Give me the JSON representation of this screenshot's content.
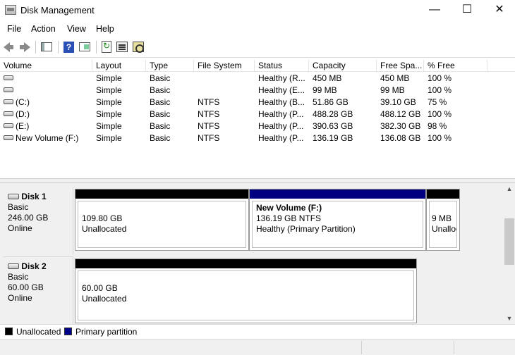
{
  "window": {
    "title": "Disk Management",
    "controls": {
      "minimize": "—",
      "maximize": "☐",
      "close": "✕"
    }
  },
  "menu": [
    "File",
    "Action",
    "View",
    "Help"
  ],
  "toolbar": {
    "icons": [
      "back-arrow-icon",
      "forward-arrow-icon",
      "console-tree-icon",
      "help-icon",
      "action-pane-icon",
      "refresh-icon",
      "properties-icon",
      "rescan-disks-icon"
    ]
  },
  "volume_list": {
    "columns": [
      "Volume",
      "Layout",
      "Type",
      "File System",
      "Status",
      "Capacity",
      "Free Spa...",
      "% Free"
    ],
    "rows": [
      {
        "volume": "",
        "layout": "Simple",
        "type": "Basic",
        "fs": "",
        "status": "Healthy (R...",
        "capacity": "450 MB",
        "free": "450 MB",
        "pct": "100 %"
      },
      {
        "volume": "",
        "layout": "Simple",
        "type": "Basic",
        "fs": "",
        "status": "Healthy (E...",
        "capacity": "99 MB",
        "free": "99 MB",
        "pct": "100 %"
      },
      {
        "volume": "(C:)",
        "layout": "Simple",
        "type": "Basic",
        "fs": "NTFS",
        "status": "Healthy (B...",
        "capacity": "51.86 GB",
        "free": "39.10 GB",
        "pct": "75 %"
      },
      {
        "volume": "(D:)",
        "layout": "Simple",
        "type": "Basic",
        "fs": "NTFS",
        "status": "Healthy (P...",
        "capacity": "488.28 GB",
        "free": "488.12 GB",
        "pct": "100 %"
      },
      {
        "volume": "(E:)",
        "layout": "Simple",
        "type": "Basic",
        "fs": "NTFS",
        "status": "Healthy (P...",
        "capacity": "390.63 GB",
        "free": "382.30 GB",
        "pct": "98 %"
      },
      {
        "volume": "New Volume (F:)",
        "layout": "Simple",
        "type": "Basic",
        "fs": "NTFS",
        "status": "Healthy (P...",
        "capacity": "136.19 GB",
        "free": "136.08 GB",
        "pct": "100 %"
      }
    ]
  },
  "disks": [
    {
      "name": "Disk 1",
      "type": "Basic",
      "size": "246.00 GB",
      "state": "Online",
      "partitions": [
        {
          "name": "",
          "line1": "109.80 GB",
          "line2": "Unallocated",
          "kind": "unallocated"
        },
        {
          "name": "New Volume  (F:)",
          "line1": "136.19 GB NTFS",
          "line2": "Healthy (Primary Partition)",
          "kind": "primary"
        },
        {
          "name": "",
          "line1": "9 MB",
          "line2": "Unallocated",
          "kind": "unallocated"
        }
      ]
    },
    {
      "name": "Disk 2",
      "type": "Basic",
      "size": "60.00 GB",
      "state": "Online",
      "partitions": [
        {
          "name": "",
          "line1": "60.00 GB",
          "line2": "Unallocated",
          "kind": "unallocated"
        }
      ]
    }
  ],
  "legend": [
    {
      "label": "Unallocated",
      "color": "#000000"
    },
    {
      "label": "Primary partition",
      "color": "#00008b"
    }
  ],
  "colors": {
    "unallocated": "#000000",
    "primary": "#000080"
  }
}
